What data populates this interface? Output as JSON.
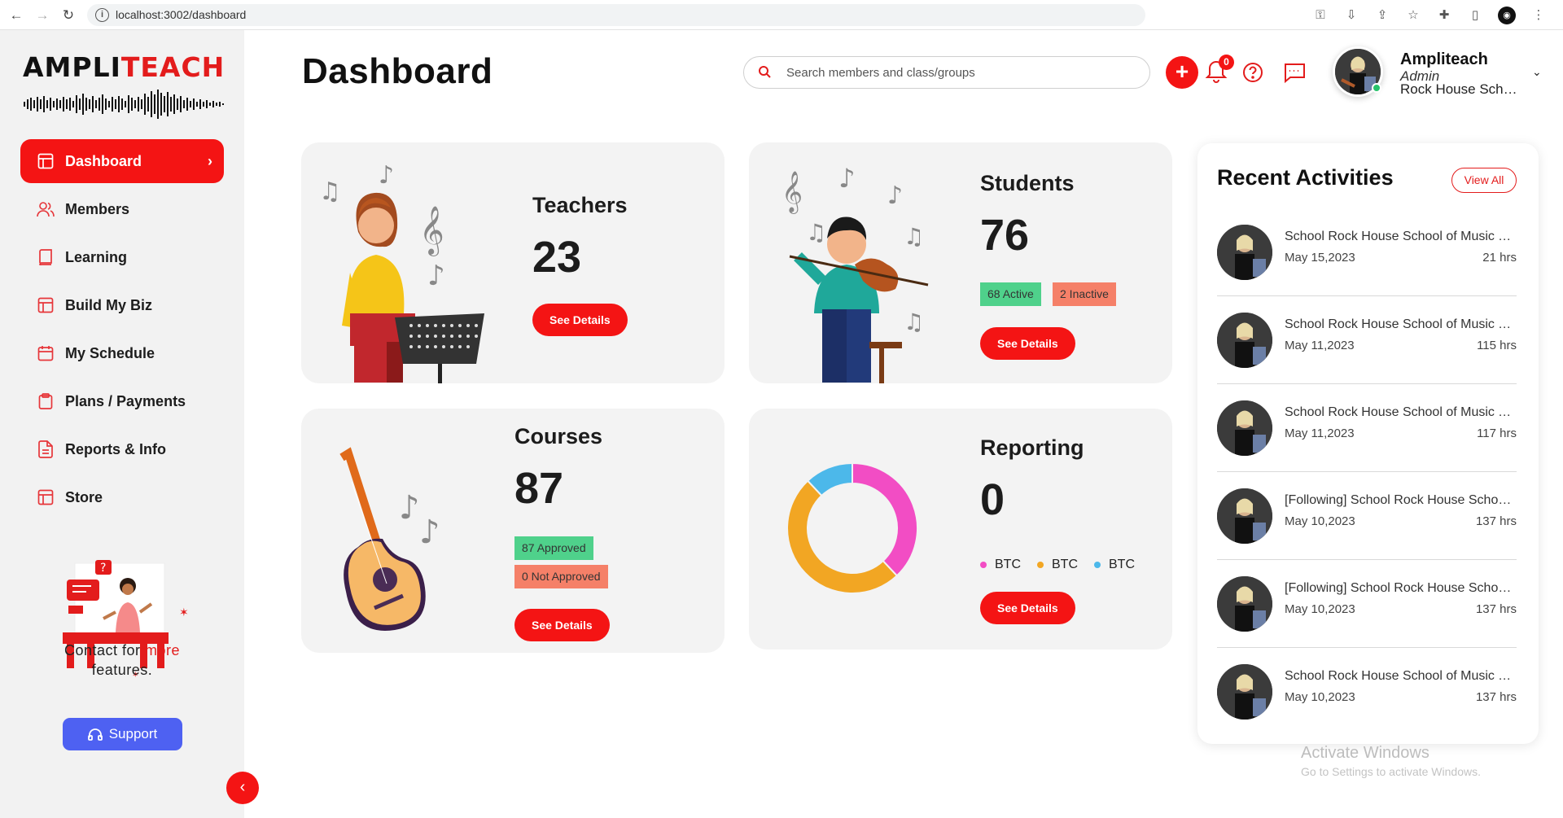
{
  "browser": {
    "url": "localhost:3002/dashboard"
  },
  "sidebar": {
    "logo": {
      "part1": "AMPLI",
      "part2": "TEACH"
    },
    "items": [
      {
        "label": "Dashboard",
        "icon": "layout-icon",
        "active": true
      },
      {
        "label": "Members",
        "icon": "users-icon"
      },
      {
        "label": "Learning",
        "icon": "book-icon"
      },
      {
        "label": "Build My Biz",
        "icon": "layout-icon"
      },
      {
        "label": "My Schedule",
        "icon": "calendar-icon"
      },
      {
        "label": "Plans / Payments",
        "icon": "clipboard-icon"
      },
      {
        "label": "Reports & Info",
        "icon": "file-text-icon"
      },
      {
        "label": "Store",
        "icon": "layout-icon"
      }
    ],
    "contact": {
      "text1": "Contact for ",
      "more": "more",
      "text2": "features."
    },
    "support_label": "Support"
  },
  "header": {
    "title": "Dashboard",
    "search_placeholder": "Search members and class/groups",
    "notification_count": "0",
    "user": {
      "name": "Ampliteach",
      "role": "Admin",
      "school": "Rock House School of Music"
    }
  },
  "cards": {
    "teachers": {
      "title": "Teachers",
      "count": "23",
      "button": "See Details"
    },
    "students": {
      "title": "Students",
      "count": "76",
      "active": "68 Active",
      "inactive": "2 Inactive",
      "button": "See Details"
    },
    "courses": {
      "title": "Courses",
      "count": "87",
      "approved": "87 Approved",
      "not_approved": "0 Not Approved",
      "button": "See Details"
    },
    "reporting": {
      "title": "Reporting",
      "count": "0",
      "button": "See Details",
      "legend": [
        {
          "label": "BTC",
          "color": "#f24dc4"
        },
        {
          "label": "BTC",
          "color": "#f2a623"
        },
        {
          "label": "BTC",
          "color": "#4cb8ea"
        }
      ]
    }
  },
  "chart_data": {
    "type": "pie",
    "donut": true,
    "labels": [
      "BTC",
      "BTC",
      "BTC"
    ],
    "values": [
      38,
      50,
      12
    ],
    "colors": [
      "#f24dc4",
      "#f2a623",
      "#4cb8ea"
    ]
  },
  "recent_activities": {
    "title": "Recent Activities",
    "view_all": "View All",
    "items": [
      {
        "text": "School Rock House School of Music Teacher",
        "date": "May 15,2023",
        "ago": "21 hrs"
      },
      {
        "text": "School Rock House School of Music Teacher",
        "date": "May 11,2023",
        "ago": "115 hrs"
      },
      {
        "text": "School Rock House School of Music Teacher",
        "date": "May 11,2023",
        "ago": "117 hrs"
      },
      {
        "text": "[Following] School Rock House School of Music",
        "date": "May 10,2023",
        "ago": "137 hrs"
      },
      {
        "text": "[Following] School Rock House School of Music",
        "date": "May 10,2023",
        "ago": "137 hrs"
      },
      {
        "text": "School Rock House School of Music Teacher",
        "date": "May 10,2023",
        "ago": "137 hrs"
      }
    ]
  },
  "watermark": {
    "line1": "Activate Windows",
    "line2": "Go to Settings to activate Windows."
  },
  "colors": {
    "accent": "#f41414",
    "support": "#4e61f2",
    "card_bg": "#f3f3f3"
  }
}
